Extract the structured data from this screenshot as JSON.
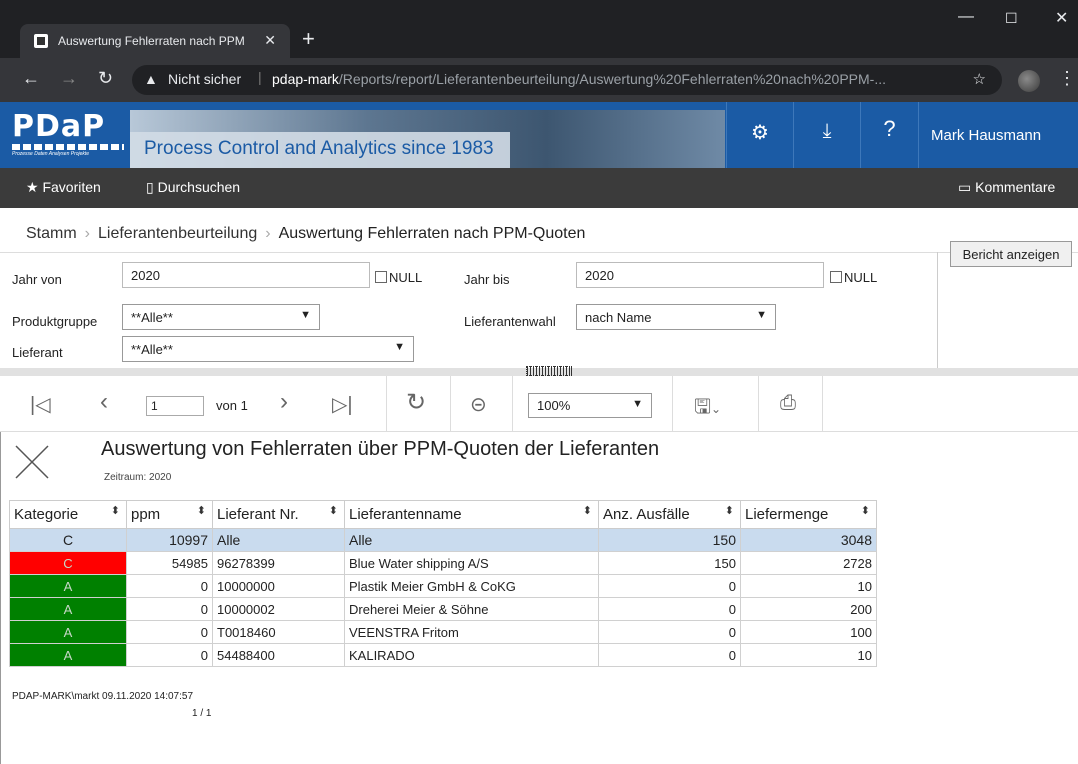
{
  "browser": {
    "tab_title": "Auswertung Fehlerraten nach PPM",
    "tab_close": "✕",
    "new_tab": "+",
    "insecure_label": "Nicht sicher",
    "url_host": "pdap-mark",
    "url_path": "/Reports/report/Lieferantenbeurteilung/Auswertung%20Fehlerraten%20nach%20PPM-..."
  },
  "header": {
    "logo_text": "PDaP",
    "logo_tagline": "Prozesse Daten Analysen Projekte",
    "banner_text": "Process Control and Analytics since 1983",
    "user_name": "Mark Hausmann"
  },
  "menu": {
    "favorites": "Favoriten",
    "browse": "Durchsuchen",
    "comments": "Kommentare"
  },
  "breadcrumb": [
    "Stamm",
    "Lieferantenbeurteilung",
    "Auswertung Fehlerraten nach PPM-Quoten"
  ],
  "params": {
    "year_from_label": "Jahr von",
    "year_from_value": "2020",
    "year_to_label": "Jahr bis",
    "year_to_value": "2020",
    "null_label": "NULL",
    "product_group_label": "Produktgruppe",
    "product_group_value": "**Alle**",
    "supplier_choice_label": "Lieferantenwahl",
    "supplier_choice_value": "nach Name",
    "supplier_label": "Lieferant",
    "supplier_value": "**Alle**",
    "show_report_button": "Bericht anzeigen"
  },
  "toolbar": {
    "page_value": "1",
    "of_label": "von 1",
    "zoom_value": "100%"
  },
  "report": {
    "title": "Auswertung von Fehlerraten über PPM-Quoten der Lieferanten",
    "subtitle": "Zeitraum: 2020",
    "columns": [
      "Kategorie",
      "ppm",
      "Lieferant Nr.",
      "Lieferantenname",
      "Anz. Ausfälle",
      "Liefermenge"
    ],
    "total_row": {
      "cat": "C",
      "ppm": "10997",
      "nr": "Alle",
      "name": "Alle",
      "failures": "150",
      "qty": "3048"
    },
    "rows": [
      {
        "cat": "C",
        "color": "#ff0000",
        "ppm": "54985",
        "nr": "96278399",
        "name": "Blue Water shipping A/S",
        "failures": "150",
        "qty": "2728"
      },
      {
        "cat": "A",
        "color": "#008000",
        "ppm": "0",
        "nr": "10000000",
        "name": "Plastik Meier GmbH & CoKG",
        "failures": "0",
        "qty": "10"
      },
      {
        "cat": "A",
        "color": "#008000",
        "ppm": "0",
        "nr": "10000002",
        "name": "Dreherei Meier & Söhne",
        "failures": "0",
        "qty": "200"
      },
      {
        "cat": "A",
        "color": "#008000",
        "ppm": "0",
        "nr": "T0018460",
        "name": "VEENSTRA Fritom",
        "failures": "0",
        "qty": "100"
      },
      {
        "cat": "A",
        "color": "#008000",
        "ppm": "0",
        "nr": "54488400",
        "name": "KALIRADO",
        "failures": "0",
        "qty": "10"
      }
    ],
    "footer_user_time": "PDAP-MARK\\markt 09.11.2020 14:07:57",
    "footer_page": "1 / 1"
  }
}
